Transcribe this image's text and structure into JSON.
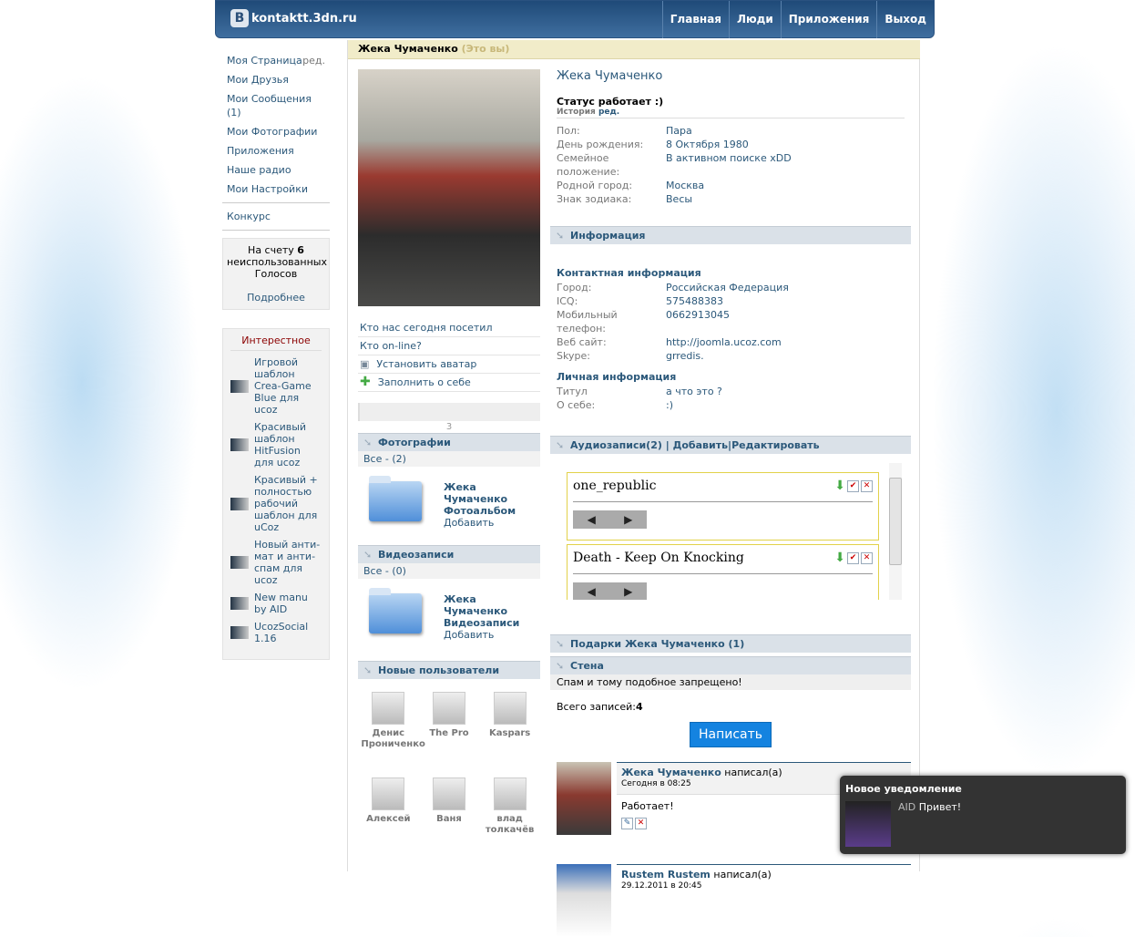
{
  "header": {
    "logo_letter": "B",
    "site": "kontaktt.3dn.ru",
    "nav": [
      "Главная",
      "Люди",
      "Приложения",
      "Выход"
    ]
  },
  "left": {
    "menu": [
      "Моя Страница",
      "Мои Друзья",
      "Мои Сообщения (1)",
      "Мои Фотографии",
      "Приложения",
      "Наше радио",
      "Мои Настройки"
    ],
    "edit": "ред.",
    "contest": "Конкурс",
    "votes": {
      "pre": "На счету ",
      "count": "6",
      "post": " неиспользованных Голосов",
      "more": "Подробнее"
    },
    "interesting": {
      "title": "Интерестное",
      "items": [
        "Игровой шаблон Crea-Game Blue для ucoz",
        "Красивый шаблон HitFusion для ucoz",
        "Красивый + полностью рабочий шаблон для uCoz",
        "Новый анти-мат и анти-спам для ucoz",
        "New manu by AID",
        "UcozSocial 1.16"
      ]
    }
  },
  "profile": {
    "name": "Жека Чумаченко",
    "its_you": "(Это вы)",
    "status": "Статус работает :)",
    "history": "История",
    "edit": "ред.",
    "basic": [
      {
        "k": "Пол:",
        "v": "Пара"
      },
      {
        "k": "День рождения:",
        "v": "8 Октября 1980"
      },
      {
        "k": "Семейное положение:",
        "v": "В активном поиске xDD"
      },
      {
        "k": "Родной город:",
        "v": "Москва"
      },
      {
        "k": "Знак зодиака:",
        "v": "Весы"
      }
    ],
    "info_title": "Информация",
    "contact_title": "Контактная информация",
    "contact": [
      {
        "k": "Город:",
        "v": "Российская Федерация"
      },
      {
        "k": "ICQ:",
        "v": "575488383"
      },
      {
        "k": "Мобильный телефон:",
        "v": "0662913045"
      },
      {
        "k": "Веб сайт:",
        "v": "http://joomla.ucoz.com"
      },
      {
        "k": "Skype:",
        "v": "grredis."
      }
    ],
    "personal_title": "Личная информация",
    "personal": [
      {
        "k": "Титул",
        "v": "а что это ?"
      },
      {
        "k": "О себе:",
        "v": ":)"
      }
    ]
  },
  "mid": {
    "links": [
      "Кто нас сегодня посетил",
      "Кто on-line?",
      "Установить аватар",
      "Заполнить о себе"
    ],
    "counter": "3",
    "photos": {
      "title": "Фотографии",
      "all": "Все - (2)",
      "album": "Жека Чумаченко Фотоальбом",
      "add": "Добавить"
    },
    "videos": {
      "title": "Видеозаписи",
      "all": "Все - (0)",
      "album": "Жека Чумаченко Видеозаписи",
      "add": "Добавить"
    },
    "new_users": {
      "title": "Новые пользователи",
      "users": [
        "Денис Проничeнко",
        "The Pro",
        "Kaspars",
        "Алексей",
        "Ваня",
        "влад толкачёв"
      ]
    }
  },
  "audio": {
    "title": "Аудиозаписи(2)",
    "sep": " | ",
    "add": "Добавить",
    "edit": "Редактировать",
    "tracks": [
      "one_republic",
      "Death - Keep On Knocking"
    ]
  },
  "gifts": {
    "title": "Подарки Жека Чумаченко (1)"
  },
  "wall": {
    "title": "Стена",
    "notice": "Спам и тому подобное запрещено!",
    "total_label": "Всего записей:",
    "total": "4",
    "write": "Написать",
    "posts": [
      {
        "author": "Жека Чумаченко",
        "wrote": "написал(а)",
        "date": "Сегодня в 08:25",
        "text": "Работает!"
      },
      {
        "author": "Rustem Rustem",
        "wrote": "написал(а)",
        "date": "29.12.2011 в 20:45"
      }
    ]
  },
  "notification": {
    "title": "Новое уведомление",
    "from": "AID",
    "text": "Привет!"
  }
}
